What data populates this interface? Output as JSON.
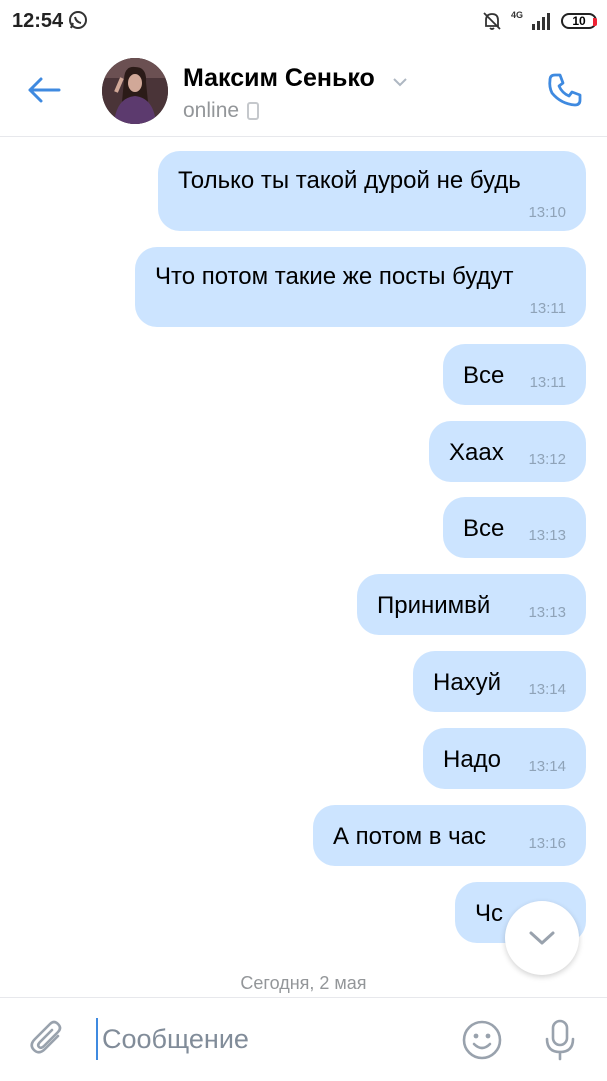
{
  "status_bar": {
    "time": "12:54",
    "network": "4G",
    "battery": "10"
  },
  "header": {
    "contact_name": "Максим Сенько",
    "contact_status": "online"
  },
  "messages": [
    {
      "text": "Только ты такой дурой не будь",
      "time": "13:10"
    },
    {
      "text": "Что потом такие же посты будут",
      "time": "13:11"
    },
    {
      "text": "Все",
      "time": "13:11"
    },
    {
      "text": "Хаах",
      "time": "13:12"
    },
    {
      "text": "Все",
      "time": "13:13"
    },
    {
      "text": "Принимвй",
      "time": "13:13"
    },
    {
      "text": "Нахуй",
      "time": "13:14"
    },
    {
      "text": "Надо",
      "time": "13:14"
    },
    {
      "text": "А потом в час",
      "time": "13:16"
    },
    {
      "text": "Чс",
      "time": ""
    }
  ],
  "date_separator": "Сегодня, 2 мая",
  "composer": {
    "placeholder": "Сообщение"
  },
  "colors": {
    "accent": "#3f8ae0",
    "bubble": "#cce4ff",
    "secondary_text": "#939699"
  }
}
